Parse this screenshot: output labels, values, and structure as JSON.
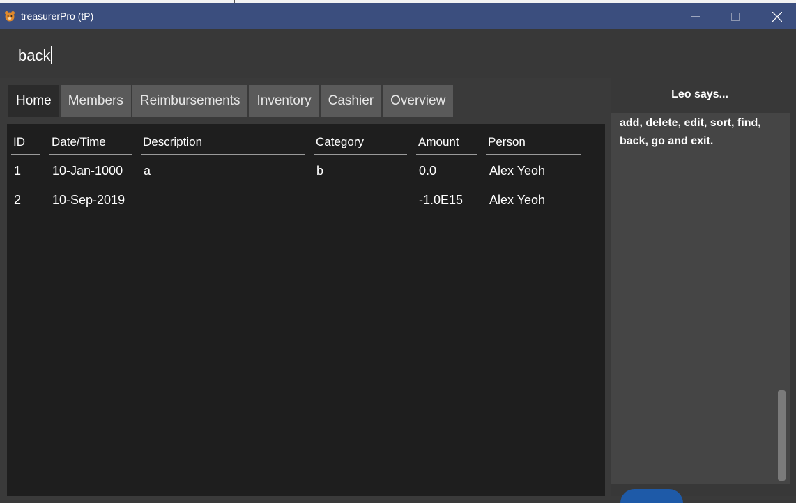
{
  "window": {
    "title": "treasurerPro (tP)",
    "minimize_icon": "minimize-icon",
    "maximize_icon": "maximize-icon",
    "close_icon": "close-icon"
  },
  "command": {
    "value": "back"
  },
  "tabs": [
    {
      "label": "Home",
      "active": true
    },
    {
      "label": "Members",
      "active": false
    },
    {
      "label": "Reimbursements",
      "active": false
    },
    {
      "label": "Inventory",
      "active": false
    },
    {
      "label": "Cashier",
      "active": false
    },
    {
      "label": "Overview",
      "active": false
    }
  ],
  "table": {
    "columns": [
      "ID",
      "Date/Time",
      "Description",
      "Category",
      "Amount",
      "Person"
    ],
    "rows": [
      [
        "1",
        "10-Jan-1000",
        "a",
        "b",
        "0.0",
        "Alex Yeoh"
      ],
      [
        "2",
        "10-Sep-2019",
        "",
        "",
        "-1.0E15",
        "Alex Yeoh"
      ]
    ]
  },
  "leo": {
    "title": "Leo says...",
    "message": "add, delete, edit, sort, find, back, go and exit."
  },
  "colors": {
    "titlebar": "#3b4e7e",
    "background": "#3a3a3a",
    "table_background": "#1e1e1e",
    "tab": "#5a5a5a",
    "tab_active": "#2b2b2b"
  }
}
